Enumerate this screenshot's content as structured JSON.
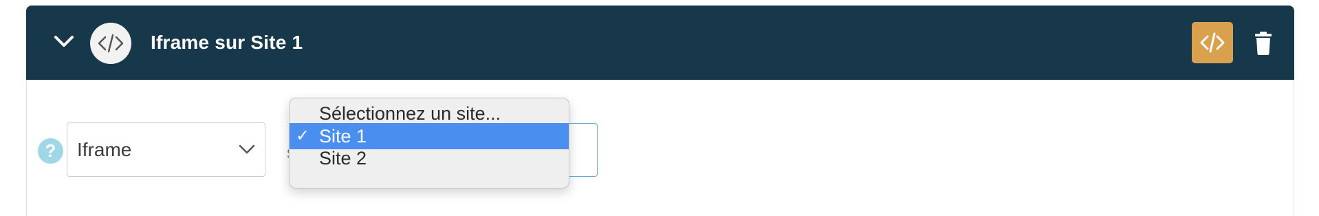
{
  "header": {
    "title": "Iframe sur Site 1",
    "collapse_icon": "chevron-down-icon",
    "type_icon": "code-icon",
    "actions": {
      "embed_icon": "code-icon",
      "delete_icon": "trash-icon"
    }
  },
  "form": {
    "help_glyph": "?",
    "type_select": {
      "value": "Iframe",
      "icon": "chevron-down-icon"
    },
    "connector": "sur",
    "site_dropdown": {
      "options": [
        {
          "label": "Sélectionnez un site...",
          "selected": false
        },
        {
          "label": "Site 1",
          "selected": true,
          "check": "✓"
        },
        {
          "label": "Site 2",
          "selected": false
        }
      ]
    }
  },
  "colors": {
    "header_bg": "#17374a",
    "accent_button": "#d9a04d",
    "selected_option": "#4a8ef0",
    "help_icon": "#9fd7e6"
  }
}
